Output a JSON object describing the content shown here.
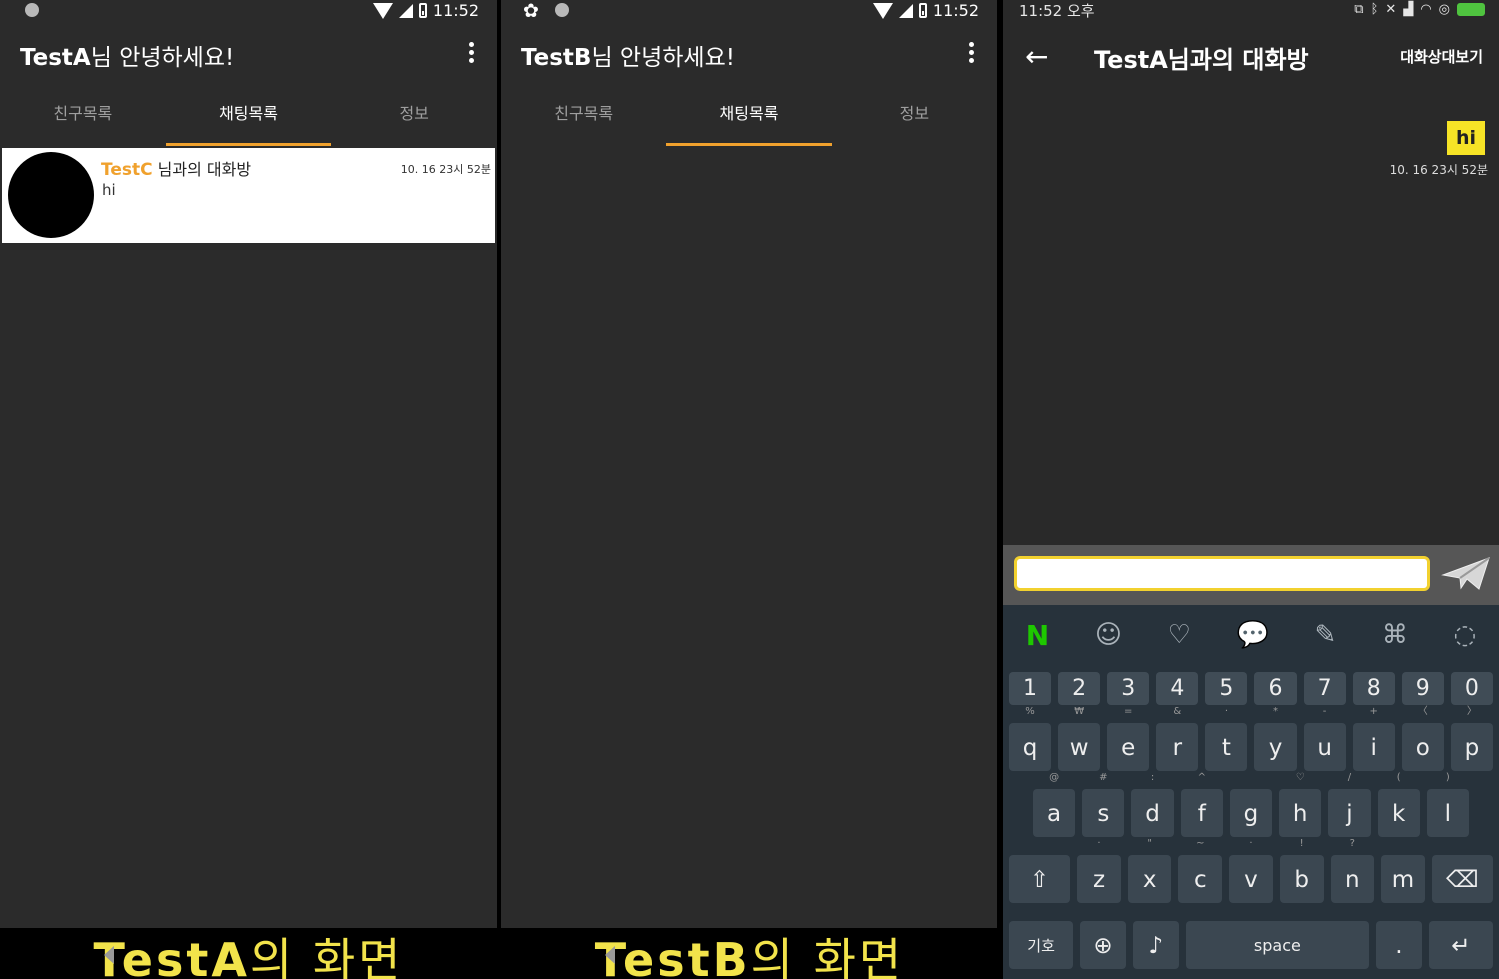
{
  "panel_a": {
    "status_time": "11:52",
    "title_name": "TestA",
    "title_suffix": "님 안녕하세요!",
    "tabs": [
      "친구목록",
      "채팅목록",
      "정보"
    ],
    "active_tab": 1,
    "chat": {
      "name": "TestC",
      "room_suffix": " 님과의 대화방",
      "time": "10. 16 23시 52분",
      "last_message": "hi"
    },
    "caption_name": "TestA",
    "caption_rest": "의 화면"
  },
  "panel_b": {
    "status_time": "11:52",
    "title_name": "TestB",
    "title_suffix": "님 안녕하세요!",
    "tabs": [
      "친구목록",
      "채팅목록",
      "정보"
    ],
    "active_tab": 1,
    "caption_name": "TestB",
    "caption_rest": "의 화면"
  },
  "panel_c": {
    "status_time": "11:52 오후",
    "room_title": "TestA님과의 대화방",
    "view_partner": "대화상대보기",
    "message": {
      "text": "hi",
      "time": "10. 16 23시 52분"
    },
    "input_value": "",
    "keyboard": {
      "tool_icons": [
        "naver-icon",
        "emoji-icon",
        "heart-icon",
        "speech-icon",
        "pen-icon",
        "translate-icon",
        "circle-icon"
      ],
      "numbers": [
        "1",
        "2",
        "3",
        "4",
        "5",
        "6",
        "7",
        "8",
        "9",
        "0"
      ],
      "row1": [
        "q",
        "w",
        "e",
        "r",
        "t",
        "y",
        "u",
        "i",
        "o",
        "p"
      ],
      "row1_hints": [
        "%",
        "₩",
        "=",
        "&",
        "·",
        "*",
        "-",
        "+",
        "〈",
        "〉"
      ],
      "row2": [
        "a",
        "s",
        "d",
        "f",
        "g",
        "h",
        "j",
        "k",
        "l"
      ],
      "row2_hints": [
        "@",
        "#",
        ":",
        "^",
        "",
        "♡",
        "/",
        "(",
        ")"
      ],
      "row3": [
        "z",
        "x",
        "c",
        "v",
        "b",
        "n",
        "m"
      ],
      "row3_hints": [
        "·",
        "\"",
        "~",
        "·",
        "!",
        "?",
        ""
      ],
      "symbol_key": "기호",
      "space_key": "space",
      "period_key": "."
    }
  },
  "colors": {
    "accent": "#f0a12d",
    "bubble": "#f6e326",
    "caption": "#f2e34b",
    "send_border": "#f2d12f"
  }
}
